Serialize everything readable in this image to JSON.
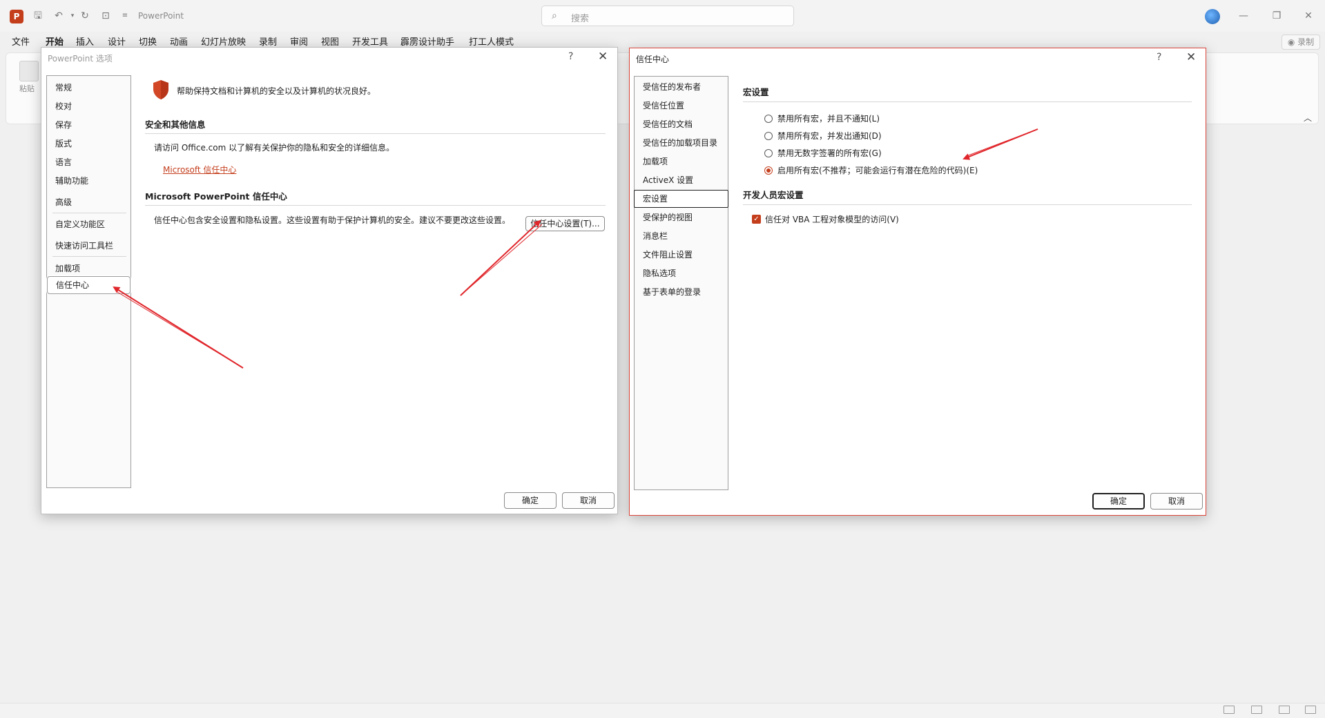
{
  "app": {
    "title": "PowerPoint",
    "logo_letter": "P",
    "search_placeholder": "搜索",
    "record_label": "◉ 录制"
  },
  "ribbon": {
    "tabs": [
      "文件",
      "开始",
      "插入",
      "设计",
      "切换",
      "动画",
      "幻灯片放映",
      "录制",
      "审阅",
      "视图",
      "开发工具",
      "霹雳设计助手",
      "打工人模式"
    ],
    "active_tab": "开始",
    "paste_label": "粘贴"
  },
  "options_dialog": {
    "title": "PowerPoint 选项",
    "help": "?",
    "close": "✕",
    "nav_items": [
      "常规",
      "校对",
      "保存",
      "版式",
      "语言",
      "辅助功能",
      "高级",
      "自定义功能区",
      "快速访问工具栏",
      "加载项",
      "信任中心"
    ],
    "selected_nav": "信任中心",
    "header_text": "帮助保持文档和计算机的安全以及计算机的状况良好。",
    "section1_title": "安全和其他信息",
    "section1_text": "请访问 Office.com 以了解有关保护你的隐私和安全的详细信息。",
    "section1_link": "Microsoft 信任中心",
    "section2_title": "Microsoft PowerPoint 信任中心",
    "section2_text": "信任中心包含安全设置和隐私设置。这些设置有助于保护计算机的安全。建议不要更改这些设置。",
    "trust_center_button": "信任中心设置(T)...",
    "ok": "确定",
    "cancel": "取消"
  },
  "trust_dialog": {
    "title": "信任中心",
    "help": "?",
    "close": "✕",
    "nav_items": [
      "受信任的发布者",
      "受信任位置",
      "受信任的文档",
      "受信任的加载项目录",
      "加载项",
      "ActiveX 设置",
      "宏设置",
      "受保护的视图",
      "消息栏",
      "文件阻止设置",
      "隐私选项",
      "基于表单的登录"
    ],
    "selected_nav": "宏设置",
    "macro_title": "宏设置",
    "macro_options": [
      {
        "label": "禁用所有宏，并且不通知(L)",
        "checked": false
      },
      {
        "label": "禁用所有宏，并发出通知(D)",
        "checked": false
      },
      {
        "label": "禁用无数字签署的所有宏(G)",
        "checked": false
      },
      {
        "label": "启用所有宏(不推荐；可能会运行有潜在危险的代码)(E)",
        "checked": true
      }
    ],
    "dev_title": "开发人员宏设置",
    "vba_label": "信任对 VBA 工程对象模型的访问(V)",
    "vba_checked": true,
    "ok": "确定",
    "cancel": "取消"
  },
  "colors": {
    "accent": "#c43e1c",
    "annotation_arrow": "#e0262b"
  },
  "icons": {
    "logo": "powerpoint-logo-icon",
    "save": "save-icon",
    "undo": "undo-icon",
    "redo": "redo-icon",
    "present": "present-icon",
    "search": "search-icon",
    "shield": "shield-icon",
    "check": "checkmark-icon"
  }
}
